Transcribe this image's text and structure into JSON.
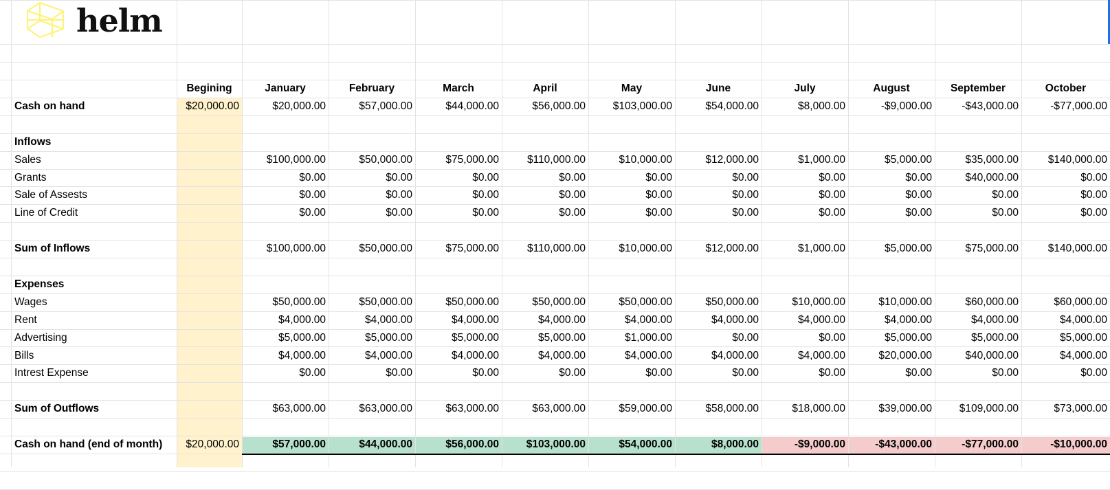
{
  "brand": {
    "name": "helm",
    "accent": "#fdf27b"
  },
  "colors": {
    "begin_highlight": "#fff2cc",
    "positive_highlight": "#b7e1cd",
    "negative_highlight": "#f4cccc",
    "gridline": "#e3e3e3"
  },
  "icons": {
    "logo": "cube-logo-icon"
  },
  "columns": [
    "Begining",
    "January",
    "February",
    "March",
    "April",
    "May",
    "June",
    "July",
    "August",
    "September",
    "October"
  ],
  "cash_on_hand": {
    "label": "Cash on hand",
    "values": [
      "$20,000.00",
      "$20,000.00",
      "$57,000.00",
      "$44,000.00",
      "$56,000.00",
      "$103,000.00",
      "$54,000.00",
      "$8,000.00",
      "-$9,000.00",
      "-$43,000.00",
      "-$77,000.00"
    ]
  },
  "inflows": {
    "heading": "Inflows",
    "rows": [
      {
        "label": "Sales",
        "values": [
          "",
          "$100,000.00",
          "$50,000.00",
          "$75,000.00",
          "$110,000.00",
          "$10,000.00",
          "$12,000.00",
          "$1,000.00",
          "$5,000.00",
          "$35,000.00",
          "$140,000.00"
        ]
      },
      {
        "label": "Grants",
        "values": [
          "",
          "$0.00",
          "$0.00",
          "$0.00",
          "$0.00",
          "$0.00",
          "$0.00",
          "$0.00",
          "$0.00",
          "$40,000.00",
          "$0.00"
        ]
      },
      {
        "label": "Sale of Assests",
        "values": [
          "",
          "$0.00",
          "$0.00",
          "$0.00",
          "$0.00",
          "$0.00",
          "$0.00",
          "$0.00",
          "$0.00",
          "$0.00",
          "$0.00"
        ]
      },
      {
        "label": "Line of Credit",
        "values": [
          "",
          "$0.00",
          "$0.00",
          "$0.00",
          "$0.00",
          "$0.00",
          "$0.00",
          "$0.00",
          "$0.00",
          "$0.00",
          "$0.00"
        ]
      }
    ],
    "sum_label": "Sum of Inflows",
    "sum_values": [
      "",
      "$100,000.00",
      "$50,000.00",
      "$75,000.00",
      "$110,000.00",
      "$10,000.00",
      "$12,000.00",
      "$1,000.00",
      "$5,000.00",
      "$75,000.00",
      "$140,000.00"
    ]
  },
  "expenses": {
    "heading": "Expenses",
    "rows": [
      {
        "label": "Wages",
        "values": [
          "",
          "$50,000.00",
          "$50,000.00",
          "$50,000.00",
          "$50,000.00",
          "$50,000.00",
          "$50,000.00",
          "$10,000.00",
          "$10,000.00",
          "$60,000.00",
          "$60,000.00"
        ]
      },
      {
        "label": "Rent",
        "values": [
          "",
          "$4,000.00",
          "$4,000.00",
          "$4,000.00",
          "$4,000.00",
          "$4,000.00",
          "$4,000.00",
          "$4,000.00",
          "$4,000.00",
          "$4,000.00",
          "$4,000.00"
        ]
      },
      {
        "label": "Advertising",
        "values": [
          "",
          "$5,000.00",
          "$5,000.00",
          "$5,000.00",
          "$5,000.00",
          "$1,000.00",
          "$0.00",
          "$0.00",
          "$5,000.00",
          "$5,000.00",
          "$5,000.00"
        ]
      },
      {
        "label": "Bills",
        "values": [
          "",
          "$4,000.00",
          "$4,000.00",
          "$4,000.00",
          "$4,000.00",
          "$4,000.00",
          "$4,000.00",
          "$4,000.00",
          "$20,000.00",
          "$40,000.00",
          "$4,000.00"
        ]
      },
      {
        "label": "Intrest Expense",
        "values": [
          "",
          "$0.00",
          "$0.00",
          "$0.00",
          "$0.00",
          "$0.00",
          "$0.00",
          "$0.00",
          "$0.00",
          "$0.00",
          "$0.00"
        ]
      }
    ],
    "sum_label": "Sum of Outflows",
    "sum_values": [
      "",
      "$63,000.00",
      "$63,000.00",
      "$63,000.00",
      "$63,000.00",
      "$59,000.00",
      "$58,000.00",
      "$18,000.00",
      "$39,000.00",
      "$109,000.00",
      "$73,000.00"
    ]
  },
  "cash_end": {
    "label": "Cash on hand (end of month)",
    "values": [
      "$20,000.00",
      "$57,000.00",
      "$44,000.00",
      "$56,000.00",
      "$103,000.00",
      "$54,000.00",
      "$8,000.00",
      "-$9,000.00",
      "-$43,000.00",
      "-$77,000.00",
      "-$10,000.00"
    ]
  }
}
